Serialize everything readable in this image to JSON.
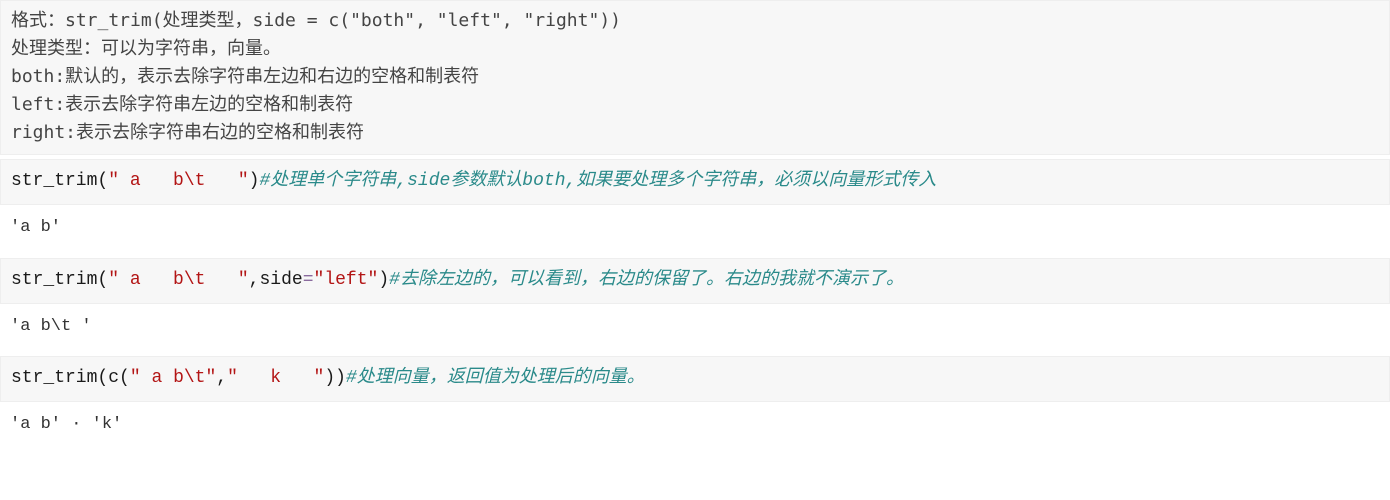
{
  "doc": {
    "line1": "格式：str_trim(处理类型，side = c(\"both\", \"left\", \"right\"))",
    "line2": "处理类型：可以为字符串，向量。",
    "line3": "both:默认的，表示去除字符串左边和右边的空格和制表符",
    "line4": "left:表示去除字符串左边的空格和制表符",
    "line5": "right:表示去除字符串右边的空格和制表符"
  },
  "code1": {
    "fn": "str_trim",
    "arg1": "\" a   b\\t   \"",
    "comment": "#处理单个字符串,side参数默认both,如果要处理多个字符串，必须以向量形式传入"
  },
  "out1": "'a   b'",
  "code2": {
    "fn": "str_trim",
    "arg1": "\" a   b\\t   \"",
    "arg2name": "side",
    "arg2val": "\"left\"",
    "comment": "#去除左边的，可以看到，右边的保留了。右边的我就不演示了。"
  },
  "out2": "'a   b\\t   '",
  "code3": {
    "fn": "str_trim",
    "cfn": "c",
    "v1": "\" a b\\t\"",
    "v2": "\"   k   \"",
    "comment": "#处理向量，返回值为处理后的向量。"
  },
  "out3": "'a b' · 'k'",
  "sep": ",",
  "eq": "="
}
